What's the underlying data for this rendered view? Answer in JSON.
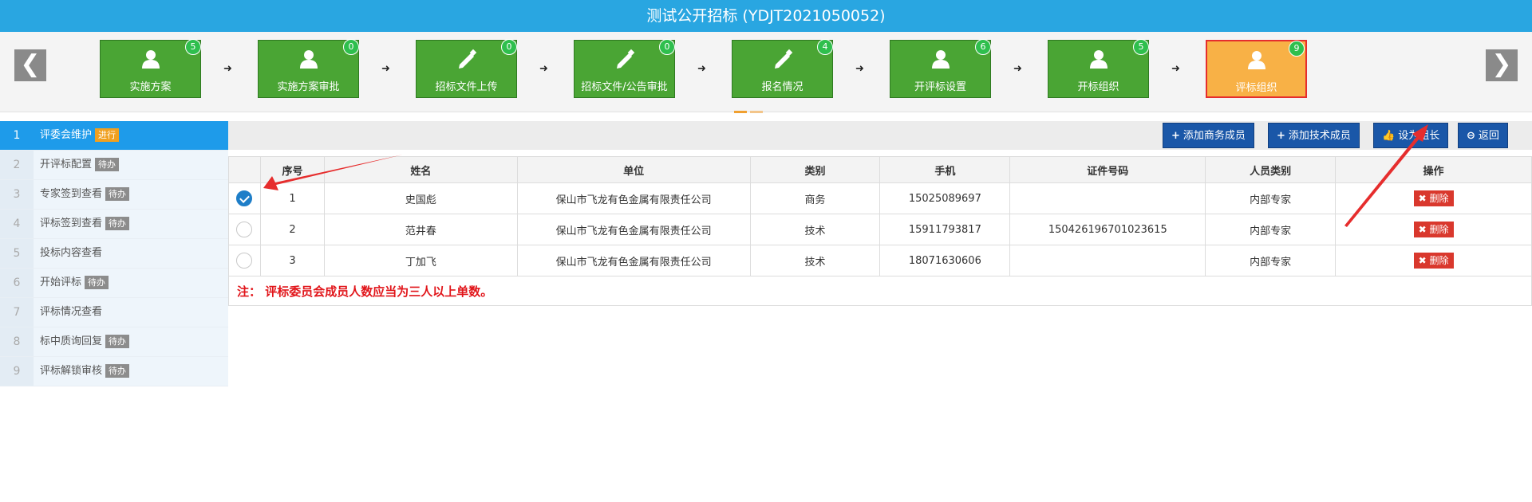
{
  "window_title": "测试公开招标 (YDJT2021050052)",
  "nav": {
    "prev": "❮",
    "next": "❯"
  },
  "steps": [
    {
      "label": "实施方案",
      "badge": "5",
      "icon": "user-icon"
    },
    {
      "label": "实施方案审批",
      "badge": "0",
      "icon": "user-icon"
    },
    {
      "label": "招标文件上传",
      "badge": "0",
      "icon": "pencil-icon"
    },
    {
      "label": "招标文件/公告审批",
      "badge": "0",
      "icon": "pencil-icon"
    },
    {
      "label": "报名情况",
      "badge": "4",
      "icon": "pencil-icon"
    },
    {
      "label": "开评标设置",
      "badge": "6",
      "icon": "user-icon"
    },
    {
      "label": "开标组织",
      "badge": "5",
      "icon": "user-icon"
    },
    {
      "label": "评标组织",
      "badge": "9",
      "icon": "user-icon",
      "active": true
    }
  ],
  "sidebar": {
    "items": [
      {
        "num": "1",
        "label": "评委会维护",
        "tag": "进行"
      },
      {
        "num": "2",
        "label": "开评标配置",
        "tag": "待办"
      },
      {
        "num": "3",
        "label": "专家签到查看",
        "tag": "待办"
      },
      {
        "num": "4",
        "label": "评标签到查看",
        "tag": "待办"
      },
      {
        "num": "5",
        "label": "投标内容查看",
        "tag": ""
      },
      {
        "num": "6",
        "label": "开始评标",
        "tag": "待办"
      },
      {
        "num": "7",
        "label": "评标情况查看",
        "tag": ""
      },
      {
        "num": "8",
        "label": "标中质询回复",
        "tag": "待办"
      },
      {
        "num": "9",
        "label": "评标解锁审核",
        "tag": "待办"
      }
    ]
  },
  "toolbar": {
    "add_business": "添加商务成员",
    "add_tech": "添加技术成员",
    "set_leader": "设为组长",
    "back": "返回"
  },
  "table": {
    "headers": [
      "",
      "序号",
      "姓名",
      "单位",
      "类别",
      "手机",
      "证件号码",
      "人员类别",
      "操作"
    ],
    "rows": [
      {
        "checked": true,
        "no": "1",
        "name": "史国彪",
        "unit": "保山市飞龙有色金属有限责任公司",
        "type": "商务",
        "phone": "15025089697",
        "id": "",
        "category": "内部专家",
        "action": "删除"
      },
      {
        "checked": false,
        "no": "2",
        "name": "范井春",
        "unit": "保山市飞龙有色金属有限责任公司",
        "type": "技术",
        "phone": "15911793817",
        "id": "150426196701023615",
        "category": "内部专家",
        "action": "删除"
      },
      {
        "checked": false,
        "no": "3",
        "name": "丁加飞",
        "unit": "保山市飞龙有色金属有限责任公司",
        "type": "技术",
        "phone": "18071630606",
        "id": "",
        "category": "内部专家",
        "action": "删除"
      }
    ],
    "note": "注： 评标委员会成员人数应当为三人以上单数。"
  },
  "colors": {
    "titlebar": "#29a6e1",
    "step_green": "#4aa534",
    "step_active": "#f8b146",
    "primary_btn": "#1a57a8",
    "danger": "#d9382d",
    "annotation": "#e62d2d"
  }
}
